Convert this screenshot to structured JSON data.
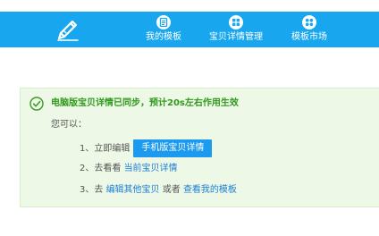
{
  "nav": {
    "logo_icon": "pen-icon",
    "items": [
      {
        "label": "我的模板",
        "icon": "template-list-icon"
      },
      {
        "label": "宝贝详情管理",
        "icon": "grid-icon"
      },
      {
        "label": "模板市场",
        "icon": "grid-dots-icon"
      }
    ],
    "background": "#18a6ee"
  },
  "notice": {
    "icon": "check-circle-icon",
    "headline": "电脑版宝贝详情已同步，预计20s左右作用生效",
    "intro": "您可以：",
    "step1": {
      "prefix": "1、立即编辑",
      "button": "手机版宝贝详情"
    },
    "step2": {
      "prefix": "2、去看看",
      "link": "当前宝贝详情"
    },
    "step3": {
      "prefix": "3、去",
      "link1": "编辑其他宝贝",
      "middle": "或者",
      "link2": "查看我的模板"
    },
    "colors": {
      "success": "#2f9a1b",
      "link": "#1c7fd6",
      "button": "#1b9af0",
      "panel": "#edf8e6"
    }
  }
}
